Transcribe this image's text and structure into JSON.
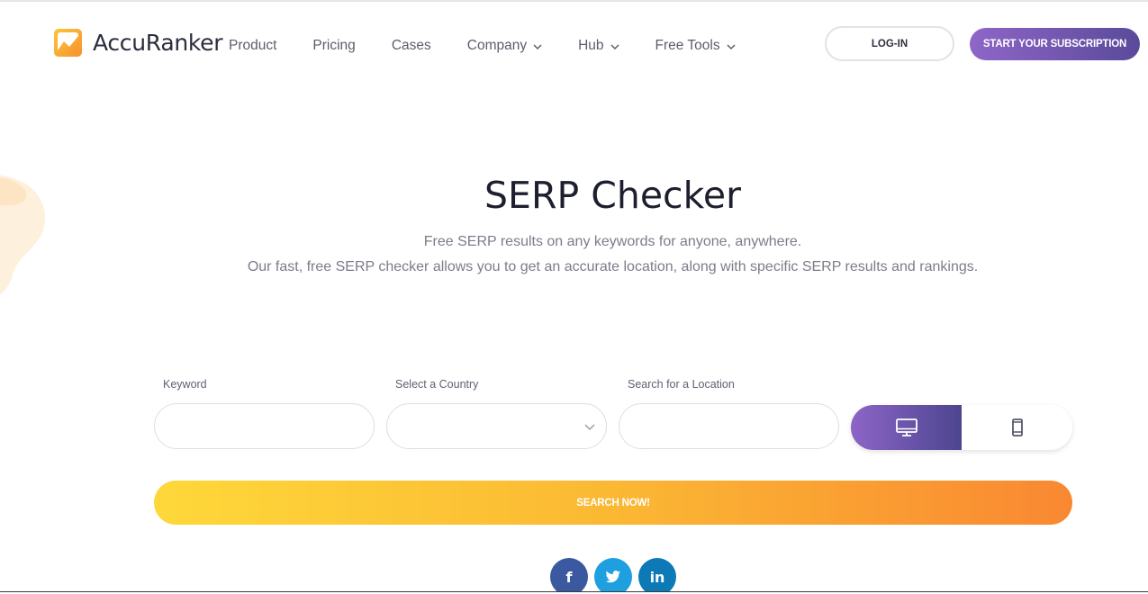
{
  "brand": {
    "name": "AccuRanker",
    "logo_icon": "accuranker-logo-icon",
    "accent": "#f9a33a"
  },
  "nav": {
    "items": [
      {
        "label": "Product",
        "has_dropdown": false
      },
      {
        "label": "Pricing",
        "has_dropdown": false
      },
      {
        "label": "Cases",
        "has_dropdown": false
      },
      {
        "label": "Company",
        "has_dropdown": true
      },
      {
        "label": "Hub",
        "has_dropdown": true
      },
      {
        "label": "Free Tools",
        "has_dropdown": true
      }
    ],
    "login_label": "LOG-IN",
    "subscribe_label": "START YOUR SUBSCRIPTION"
  },
  "hero": {
    "title": "SERP Checker",
    "subtitle_line1": "Free SERP results on any keywords for anyone, anywhere.",
    "subtitle_line2": "Our fast, free SERP checker allows you to get an accurate location, along with specific SERP results and rankings."
  },
  "form": {
    "keyword": {
      "label": "Keyword",
      "value": ""
    },
    "country": {
      "label": "Select a Country",
      "value": ""
    },
    "location": {
      "label": "Search for a Location",
      "value": ""
    },
    "device_toggle": {
      "selected": "desktop",
      "options": [
        "desktop-icon",
        "mobile-icon"
      ]
    },
    "search_label": "SEARCH NOW!"
  },
  "share": {
    "facebook_glyph": "f",
    "linkedin_glyph": "in",
    "colors": {
      "facebook": "#3b59a0",
      "twitter": "#1e9fe0",
      "linkedin": "#0d79b6"
    }
  },
  "colors": {
    "primary_purple": "#8e66c8",
    "search_gradient_start": "#fed83a",
    "search_gradient_end": "#f98832"
  }
}
